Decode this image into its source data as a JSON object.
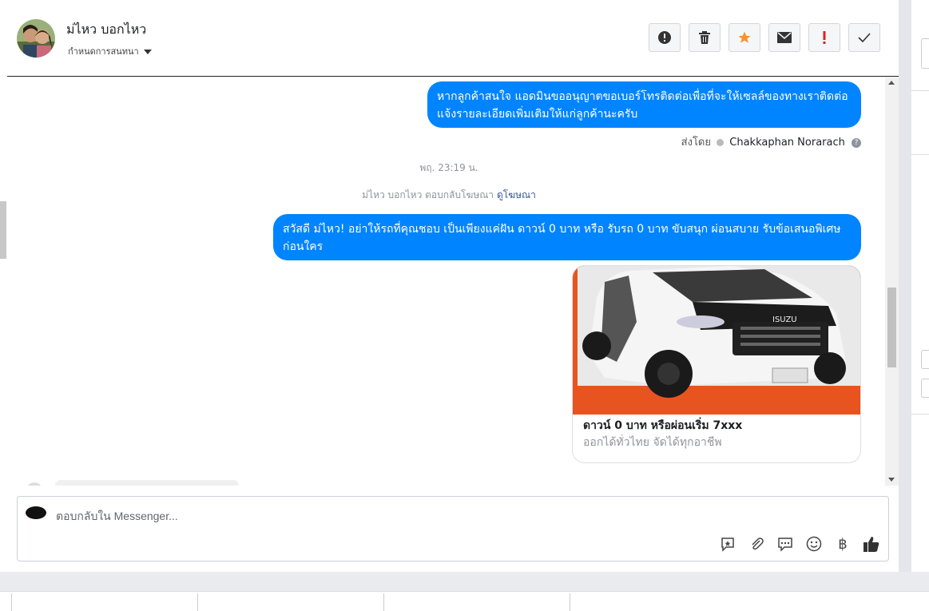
{
  "header": {
    "contact_name": "ม่ไหว บอกไหว",
    "assign_label": "กำหนดการสนทนา",
    "actions": [
      {
        "icon": "exclamation-circle-icon",
        "glyph": "!"
      },
      {
        "icon": "trash-icon",
        "glyph": ""
      },
      {
        "icon": "star-icon",
        "glyph": "★"
      },
      {
        "icon": "envelope-icon",
        "glyph": "✉"
      },
      {
        "icon": "spam-exclamation-icon",
        "glyph": "!"
      },
      {
        "icon": "check-icon",
        "glyph": "✓"
      }
    ]
  },
  "messages": {
    "msg1": "หากลูกค้าสนใจ แอดมินขออนุญาตขอเบอร์โทรติดต่อเพื่อที่จะให้เซลล์ของทางเราติดต่อแจ้งรายละเอียดเพิ่มเติมให้แก่ลูกค้านะครับ",
    "sent_by_label": "ส่งโดย",
    "sent_by_name": "Chakkaphan Norarach",
    "timestamp": "พฤ. 23:19 น.",
    "ad_reply_text": "ม่ไหว บอกไหว ตอบกลับโฆษณา",
    "ad_link": "ดูโฆษณา",
    "msg2": "สวัสดี ม่ไหว! อย่าให้รถที่คุณชอบ เป็นเพียงแค่ฝัน ดาวน์ 0 บาท หรือ รับรถ 0 บาท ขับสนุก ผ่อนสบาย รับข้อเสนอพิเศษก่อนใคร",
    "card_title": "ดาวน์ 0 บาท หรือผ่อนเริ่ม 7xxx",
    "card_subtitle": "ออกได้ทั่วไทย จัดได้ทุกอาชีพ",
    "card_badge": "ISUZU"
  },
  "composer": {
    "placeholder": "ตอบกลับใน Messenger...",
    "tools": [
      "saved-reply-icon",
      "attachment-icon",
      "chat-bubble-icon",
      "emoji-icon",
      "baht-icon",
      "thumbs-up-icon"
    ],
    "baht_glyph": "฿"
  },
  "colors": {
    "bubble": "#0084ff",
    "star": "#f7923b",
    "spam": "#e02020",
    "card_accent": "#e85420"
  }
}
